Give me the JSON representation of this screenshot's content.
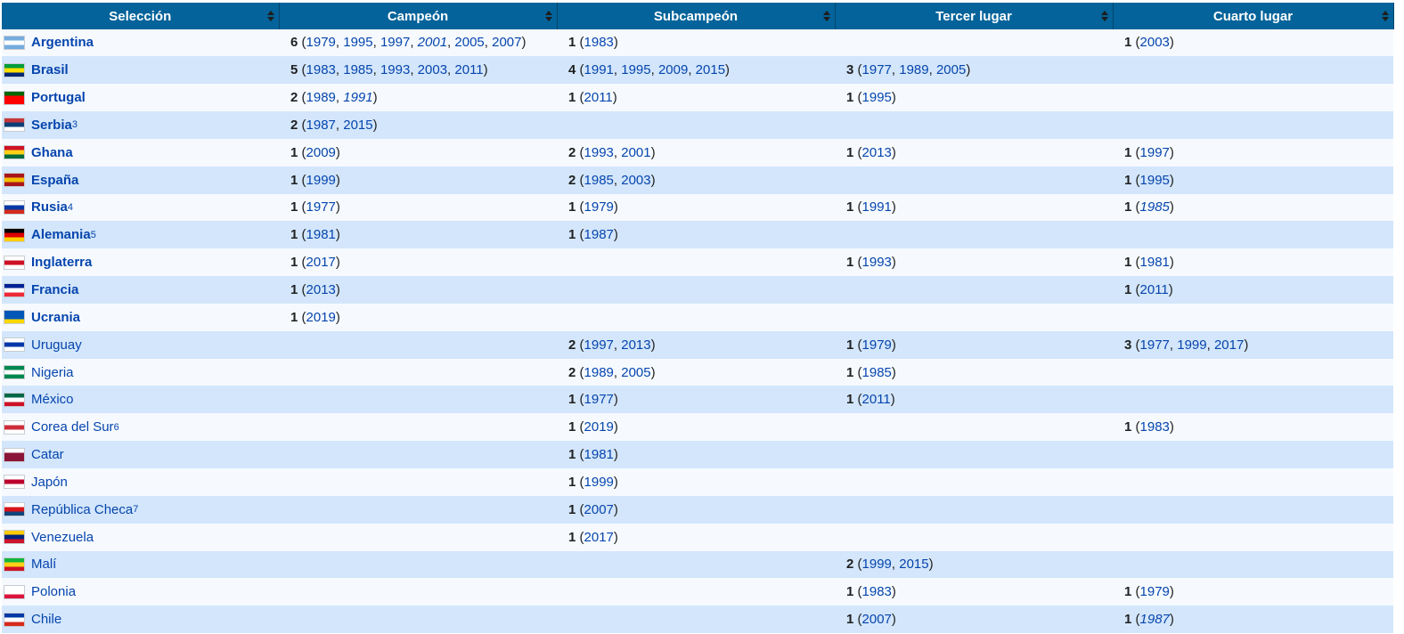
{
  "headers": [
    "Selección",
    "Campeón",
    "Subcampeón",
    "Tercer lugar",
    "Cuarto lugar"
  ],
  "rows": [
    {
      "team": "Argentina",
      "bold": true,
      "sup": "",
      "flag": "argentina-flag-icon",
      "colors": [
        "#74acdf",
        "#ffffff",
        "#74acdf"
      ],
      "cols": [
        {
          "count": "6",
          "years": [
            {
              "y": "1979"
            },
            {
              "y": "1995"
            },
            {
              "y": "1997"
            },
            {
              "y": "2001",
              "it": true
            },
            {
              "y": "2005"
            },
            {
              "y": "2007"
            }
          ]
        },
        {
          "count": "1",
          "years": [
            {
              "y": "1983"
            }
          ]
        },
        null,
        {
          "count": "1",
          "years": [
            {
              "y": "2003"
            }
          ]
        }
      ]
    },
    {
      "team": "Brasil",
      "bold": true,
      "sup": "",
      "flag": "brazil-flag-icon",
      "colors": [
        "#009c3b",
        "#ffdf00",
        "#002776"
      ],
      "cols": [
        {
          "count": "5",
          "years": [
            {
              "y": "1983"
            },
            {
              "y": "1985"
            },
            {
              "y": "1993"
            },
            {
              "y": "2003"
            },
            {
              "y": "2011"
            }
          ]
        },
        {
          "count": "4",
          "years": [
            {
              "y": "1991"
            },
            {
              "y": "1995"
            },
            {
              "y": "2009"
            },
            {
              "y": "2015"
            }
          ]
        },
        {
          "count": "3",
          "years": [
            {
              "y": "1977"
            },
            {
              "y": "1989"
            },
            {
              "y": "2005"
            }
          ]
        },
        null
      ]
    },
    {
      "team": "Portugal",
      "bold": true,
      "sup": "",
      "flag": "portugal-flag-icon",
      "colors": [
        "#006600",
        "#ff0000",
        "#ff0000"
      ],
      "cols": [
        {
          "count": "2",
          "years": [
            {
              "y": "1989"
            },
            {
              "y": "1991",
              "it": true
            }
          ]
        },
        {
          "count": "1",
          "years": [
            {
              "y": "2011"
            }
          ]
        },
        {
          "count": "1",
          "years": [
            {
              "y": "1995"
            }
          ]
        },
        null
      ]
    },
    {
      "team": "Serbia",
      "bold": true,
      "sup": "3",
      "flag": "serbia-flag-icon",
      "colors": [
        "#c6363c",
        "#0c4076",
        "#ffffff"
      ],
      "cols": [
        {
          "count": "2",
          "years": [
            {
              "y": "1987"
            },
            {
              "y": "2015"
            }
          ]
        },
        null,
        null,
        null
      ]
    },
    {
      "team": "Ghana",
      "bold": true,
      "sup": "",
      "flag": "ghana-flag-icon",
      "colors": [
        "#ce1126",
        "#fcd116",
        "#006b3f"
      ],
      "cols": [
        {
          "count": "1",
          "years": [
            {
              "y": "2009"
            }
          ]
        },
        {
          "count": "2",
          "years": [
            {
              "y": "1993"
            },
            {
              "y": "2001"
            }
          ]
        },
        {
          "count": "1",
          "years": [
            {
              "y": "2013"
            }
          ]
        },
        {
          "count": "1",
          "years": [
            {
              "y": "1997"
            }
          ]
        }
      ]
    },
    {
      "team": "España",
      "bold": true,
      "sup": "",
      "flag": "spain-flag-icon",
      "colors": [
        "#aa151b",
        "#f1bf00",
        "#aa151b"
      ],
      "cols": [
        {
          "count": "1",
          "years": [
            {
              "y": "1999"
            }
          ]
        },
        {
          "count": "2",
          "years": [
            {
              "y": "1985"
            },
            {
              "y": "2003"
            }
          ]
        },
        null,
        {
          "count": "1",
          "years": [
            {
              "y": "1995"
            }
          ]
        }
      ]
    },
    {
      "team": "Rusia",
      "bold": true,
      "sup": "4",
      "flag": "russia-flag-icon",
      "colors": [
        "#ffffff",
        "#0039a6",
        "#d52b1e"
      ],
      "cols": [
        {
          "count": "1",
          "years": [
            {
              "y": "1977"
            }
          ]
        },
        {
          "count": "1",
          "years": [
            {
              "y": "1979"
            }
          ]
        },
        {
          "count": "1",
          "years": [
            {
              "y": "1991"
            }
          ]
        },
        {
          "count": "1",
          "years": [
            {
              "y": "1985",
              "it": true
            }
          ]
        }
      ]
    },
    {
      "team": "Alemania",
      "bold": true,
      "sup": "5",
      "flag": "germany-flag-icon",
      "colors": [
        "#000000",
        "#dd0000",
        "#ffce00"
      ],
      "cols": [
        {
          "count": "1",
          "years": [
            {
              "y": "1981"
            }
          ]
        },
        {
          "count": "1",
          "years": [
            {
              "y": "1987"
            }
          ]
        },
        null,
        null
      ]
    },
    {
      "team": "Inglaterra",
      "bold": true,
      "sup": "",
      "flag": "england-flag-icon",
      "colors": [
        "#ffffff",
        "#ce1124",
        "#ffffff"
      ],
      "cols": [
        {
          "count": "1",
          "years": [
            {
              "y": "2017"
            }
          ]
        },
        null,
        {
          "count": "1",
          "years": [
            {
              "y": "1993"
            }
          ]
        },
        {
          "count": "1",
          "years": [
            {
              "y": "1981"
            }
          ]
        }
      ]
    },
    {
      "team": "Francia",
      "bold": true,
      "sup": "",
      "flag": "france-flag-icon",
      "colors": [
        "#002395",
        "#ffffff",
        "#ed2939"
      ],
      "cols": [
        {
          "count": "1",
          "years": [
            {
              "y": "2013"
            }
          ]
        },
        null,
        null,
        {
          "count": "1",
          "years": [
            {
              "y": "2011"
            }
          ]
        }
      ]
    },
    {
      "team": "Ucrania",
      "bold": true,
      "sup": "",
      "flag": "ukraine-flag-icon",
      "colors": [
        "#0057b7",
        "#0057b7",
        "#ffd700"
      ],
      "cols": [
        {
          "count": "1",
          "years": [
            {
              "y": "2019"
            }
          ]
        },
        null,
        null,
        null
      ]
    },
    {
      "team": "Uruguay",
      "bold": false,
      "sup": "",
      "flag": "uruguay-flag-icon",
      "colors": [
        "#ffffff",
        "#0038a8",
        "#ffffff"
      ],
      "cols": [
        null,
        {
          "count": "2",
          "years": [
            {
              "y": "1997"
            },
            {
              "y": "2013"
            }
          ]
        },
        {
          "count": "1",
          "years": [
            {
              "y": "1979"
            }
          ]
        },
        {
          "count": "3",
          "years": [
            {
              "y": "1977"
            },
            {
              "y": "1999"
            },
            {
              "y": "2017"
            }
          ]
        }
      ]
    },
    {
      "team": "Nigeria",
      "bold": false,
      "sup": "",
      "flag": "nigeria-flag-icon",
      "colors": [
        "#008751",
        "#ffffff",
        "#008751"
      ],
      "cols": [
        null,
        {
          "count": "2",
          "years": [
            {
              "y": "1989"
            },
            {
              "y": "2005"
            }
          ]
        },
        {
          "count": "1",
          "years": [
            {
              "y": "1985"
            }
          ]
        },
        null
      ]
    },
    {
      "team": "México",
      "bold": false,
      "sup": "",
      "flag": "mexico-flag-icon",
      "colors": [
        "#006847",
        "#ffffff",
        "#ce1126"
      ],
      "cols": [
        null,
        {
          "count": "1",
          "years": [
            {
              "y": "1977"
            }
          ]
        },
        {
          "count": "1",
          "years": [
            {
              "y": "2011"
            }
          ]
        },
        null
      ]
    },
    {
      "team": "Corea del Sur",
      "bold": false,
      "sup": "6",
      "flag": "south-korea-flag-icon",
      "colors": [
        "#ffffff",
        "#cd2e3a",
        "#ffffff"
      ],
      "cols": [
        null,
        {
          "count": "1",
          "years": [
            {
              "y": "2019"
            }
          ]
        },
        null,
        {
          "count": "1",
          "years": [
            {
              "y": "1983"
            }
          ]
        }
      ]
    },
    {
      "team": "Catar",
      "bold": false,
      "sup": "",
      "flag": "qatar-flag-icon",
      "colors": [
        "#ffffff",
        "#8a1538",
        "#8a1538"
      ],
      "cols": [
        null,
        {
          "count": "1",
          "years": [
            {
              "y": "1981"
            }
          ]
        },
        null,
        null
      ]
    },
    {
      "team": "Japón",
      "bold": false,
      "sup": "",
      "flag": "japan-flag-icon",
      "colors": [
        "#ffffff",
        "#bc002d",
        "#ffffff"
      ],
      "cols": [
        null,
        {
          "count": "1",
          "years": [
            {
              "y": "1999"
            }
          ]
        },
        null,
        null
      ]
    },
    {
      "team": "República Checa",
      "bold": false,
      "sup": "7",
      "flag": "czech-flag-icon",
      "colors": [
        "#ffffff",
        "#d7141a",
        "#11457e"
      ],
      "cols": [
        null,
        {
          "count": "1",
          "years": [
            {
              "y": "2007"
            }
          ]
        },
        null,
        null
      ]
    },
    {
      "team": "Venezuela",
      "bold": false,
      "sup": "",
      "flag": "venezuela-flag-icon",
      "colors": [
        "#ffcc00",
        "#00247d",
        "#cf142b"
      ],
      "cols": [
        null,
        {
          "count": "1",
          "years": [
            {
              "y": "2017"
            }
          ]
        },
        null,
        null
      ]
    },
    {
      "team": "Malí",
      "bold": false,
      "sup": "",
      "flag": "mali-flag-icon",
      "colors": [
        "#14b53a",
        "#fcd116",
        "#ce1126"
      ],
      "cols": [
        null,
        null,
        {
          "count": "2",
          "years": [
            {
              "y": "1999"
            },
            {
              "y": "2015"
            }
          ]
        },
        null
      ]
    },
    {
      "team": "Polonia",
      "bold": false,
      "sup": "",
      "flag": "poland-flag-icon",
      "colors": [
        "#ffffff",
        "#ffffff",
        "#dc143c"
      ],
      "cols": [
        null,
        null,
        {
          "count": "1",
          "years": [
            {
              "y": "1983"
            }
          ]
        },
        {
          "count": "1",
          "years": [
            {
              "y": "1979"
            }
          ]
        }
      ]
    },
    {
      "team": "Chile",
      "bold": false,
      "sup": "",
      "flag": "chile-flag-icon",
      "colors": [
        "#0039a6",
        "#ffffff",
        "#d52b1e"
      ],
      "cols": [
        null,
        null,
        {
          "count": "1",
          "years": [
            {
              "y": "2007"
            }
          ]
        },
        {
          "count": "1",
          "years": [
            {
              "y": "1987",
              "it": true
            }
          ]
        }
      ]
    }
  ]
}
